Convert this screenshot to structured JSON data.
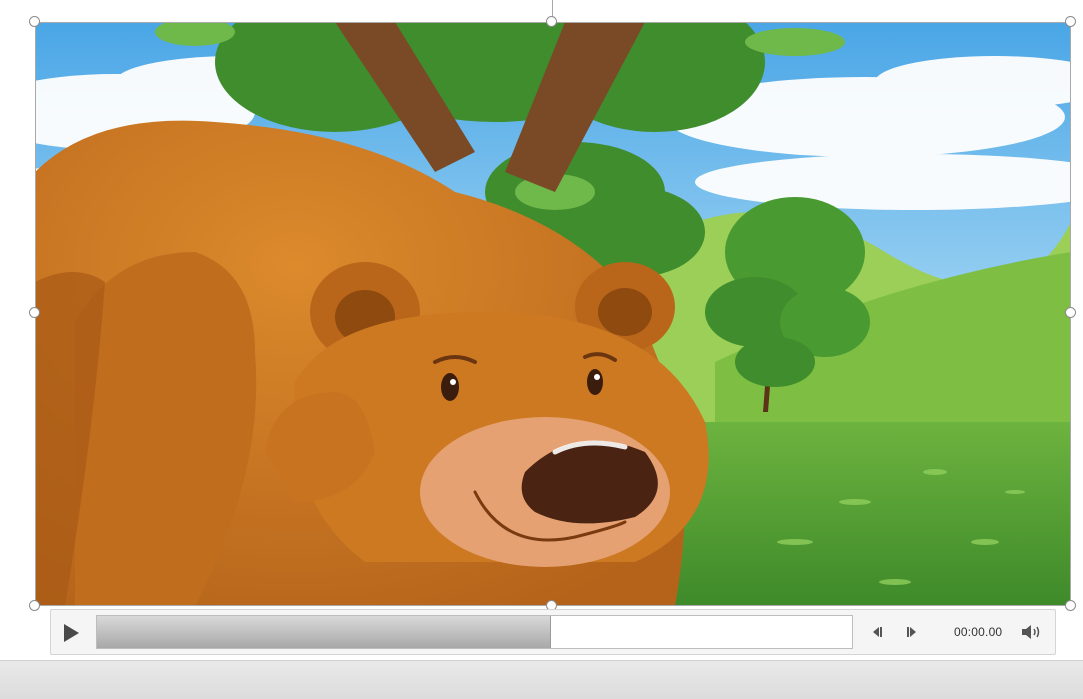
{
  "player": {
    "time_display": "00:00.00",
    "progress_fraction": 0.6,
    "icons": {
      "play": "play-icon",
      "step_back": "step-back-icon",
      "step_forward": "step-forward-icon",
      "volume": "volume-icon"
    }
  },
  "colors": {
    "sky": "#5bb6ea",
    "cloud": "#ffffff",
    "grass": "#5aa536",
    "hill": "#8cc84a",
    "bear_fur": "#c8741c",
    "bear_dark": "#9a5512",
    "muzzle": "#e7a577",
    "nose": "#4a2313",
    "tree_trunk": "#7a4a26",
    "leaf": "#3f8d2c",
    "progress": "#b0b0b0"
  }
}
